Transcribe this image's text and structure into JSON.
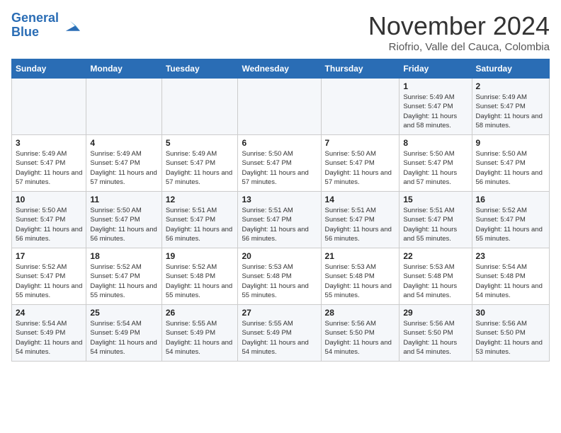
{
  "header": {
    "logo_line1": "General",
    "logo_line2": "Blue",
    "month_title": "November 2024",
    "location": "Riofrio, Valle del Cauca, Colombia"
  },
  "weekdays": [
    "Sunday",
    "Monday",
    "Tuesday",
    "Wednesday",
    "Thursday",
    "Friday",
    "Saturday"
  ],
  "weeks": [
    [
      {
        "day": "",
        "info": ""
      },
      {
        "day": "",
        "info": ""
      },
      {
        "day": "",
        "info": ""
      },
      {
        "day": "",
        "info": ""
      },
      {
        "day": "",
        "info": ""
      },
      {
        "day": "1",
        "info": "Sunrise: 5:49 AM\nSunset: 5:47 PM\nDaylight: 11 hours and 58 minutes."
      },
      {
        "day": "2",
        "info": "Sunrise: 5:49 AM\nSunset: 5:47 PM\nDaylight: 11 hours and 58 minutes."
      }
    ],
    [
      {
        "day": "3",
        "info": "Sunrise: 5:49 AM\nSunset: 5:47 PM\nDaylight: 11 hours and 57 minutes."
      },
      {
        "day": "4",
        "info": "Sunrise: 5:49 AM\nSunset: 5:47 PM\nDaylight: 11 hours and 57 minutes."
      },
      {
        "day": "5",
        "info": "Sunrise: 5:49 AM\nSunset: 5:47 PM\nDaylight: 11 hours and 57 minutes."
      },
      {
        "day": "6",
        "info": "Sunrise: 5:50 AM\nSunset: 5:47 PM\nDaylight: 11 hours and 57 minutes."
      },
      {
        "day": "7",
        "info": "Sunrise: 5:50 AM\nSunset: 5:47 PM\nDaylight: 11 hours and 57 minutes."
      },
      {
        "day": "8",
        "info": "Sunrise: 5:50 AM\nSunset: 5:47 PM\nDaylight: 11 hours and 57 minutes."
      },
      {
        "day": "9",
        "info": "Sunrise: 5:50 AM\nSunset: 5:47 PM\nDaylight: 11 hours and 56 minutes."
      }
    ],
    [
      {
        "day": "10",
        "info": "Sunrise: 5:50 AM\nSunset: 5:47 PM\nDaylight: 11 hours and 56 minutes."
      },
      {
        "day": "11",
        "info": "Sunrise: 5:50 AM\nSunset: 5:47 PM\nDaylight: 11 hours and 56 minutes."
      },
      {
        "day": "12",
        "info": "Sunrise: 5:51 AM\nSunset: 5:47 PM\nDaylight: 11 hours and 56 minutes."
      },
      {
        "day": "13",
        "info": "Sunrise: 5:51 AM\nSunset: 5:47 PM\nDaylight: 11 hours and 56 minutes."
      },
      {
        "day": "14",
        "info": "Sunrise: 5:51 AM\nSunset: 5:47 PM\nDaylight: 11 hours and 56 minutes."
      },
      {
        "day": "15",
        "info": "Sunrise: 5:51 AM\nSunset: 5:47 PM\nDaylight: 11 hours and 55 minutes."
      },
      {
        "day": "16",
        "info": "Sunrise: 5:52 AM\nSunset: 5:47 PM\nDaylight: 11 hours and 55 minutes."
      }
    ],
    [
      {
        "day": "17",
        "info": "Sunrise: 5:52 AM\nSunset: 5:47 PM\nDaylight: 11 hours and 55 minutes."
      },
      {
        "day": "18",
        "info": "Sunrise: 5:52 AM\nSunset: 5:47 PM\nDaylight: 11 hours and 55 minutes."
      },
      {
        "day": "19",
        "info": "Sunrise: 5:52 AM\nSunset: 5:48 PM\nDaylight: 11 hours and 55 minutes."
      },
      {
        "day": "20",
        "info": "Sunrise: 5:53 AM\nSunset: 5:48 PM\nDaylight: 11 hours and 55 minutes."
      },
      {
        "day": "21",
        "info": "Sunrise: 5:53 AM\nSunset: 5:48 PM\nDaylight: 11 hours and 55 minutes."
      },
      {
        "day": "22",
        "info": "Sunrise: 5:53 AM\nSunset: 5:48 PM\nDaylight: 11 hours and 54 minutes."
      },
      {
        "day": "23",
        "info": "Sunrise: 5:54 AM\nSunset: 5:48 PM\nDaylight: 11 hours and 54 minutes."
      }
    ],
    [
      {
        "day": "24",
        "info": "Sunrise: 5:54 AM\nSunset: 5:49 PM\nDaylight: 11 hours and 54 minutes."
      },
      {
        "day": "25",
        "info": "Sunrise: 5:54 AM\nSunset: 5:49 PM\nDaylight: 11 hours and 54 minutes."
      },
      {
        "day": "26",
        "info": "Sunrise: 5:55 AM\nSunset: 5:49 PM\nDaylight: 11 hours and 54 minutes."
      },
      {
        "day": "27",
        "info": "Sunrise: 5:55 AM\nSunset: 5:49 PM\nDaylight: 11 hours and 54 minutes."
      },
      {
        "day": "28",
        "info": "Sunrise: 5:56 AM\nSunset: 5:50 PM\nDaylight: 11 hours and 54 minutes."
      },
      {
        "day": "29",
        "info": "Sunrise: 5:56 AM\nSunset: 5:50 PM\nDaylight: 11 hours and 54 minutes."
      },
      {
        "day": "30",
        "info": "Sunrise: 5:56 AM\nSunset: 5:50 PM\nDaylight: 11 hours and 53 minutes."
      }
    ]
  ]
}
